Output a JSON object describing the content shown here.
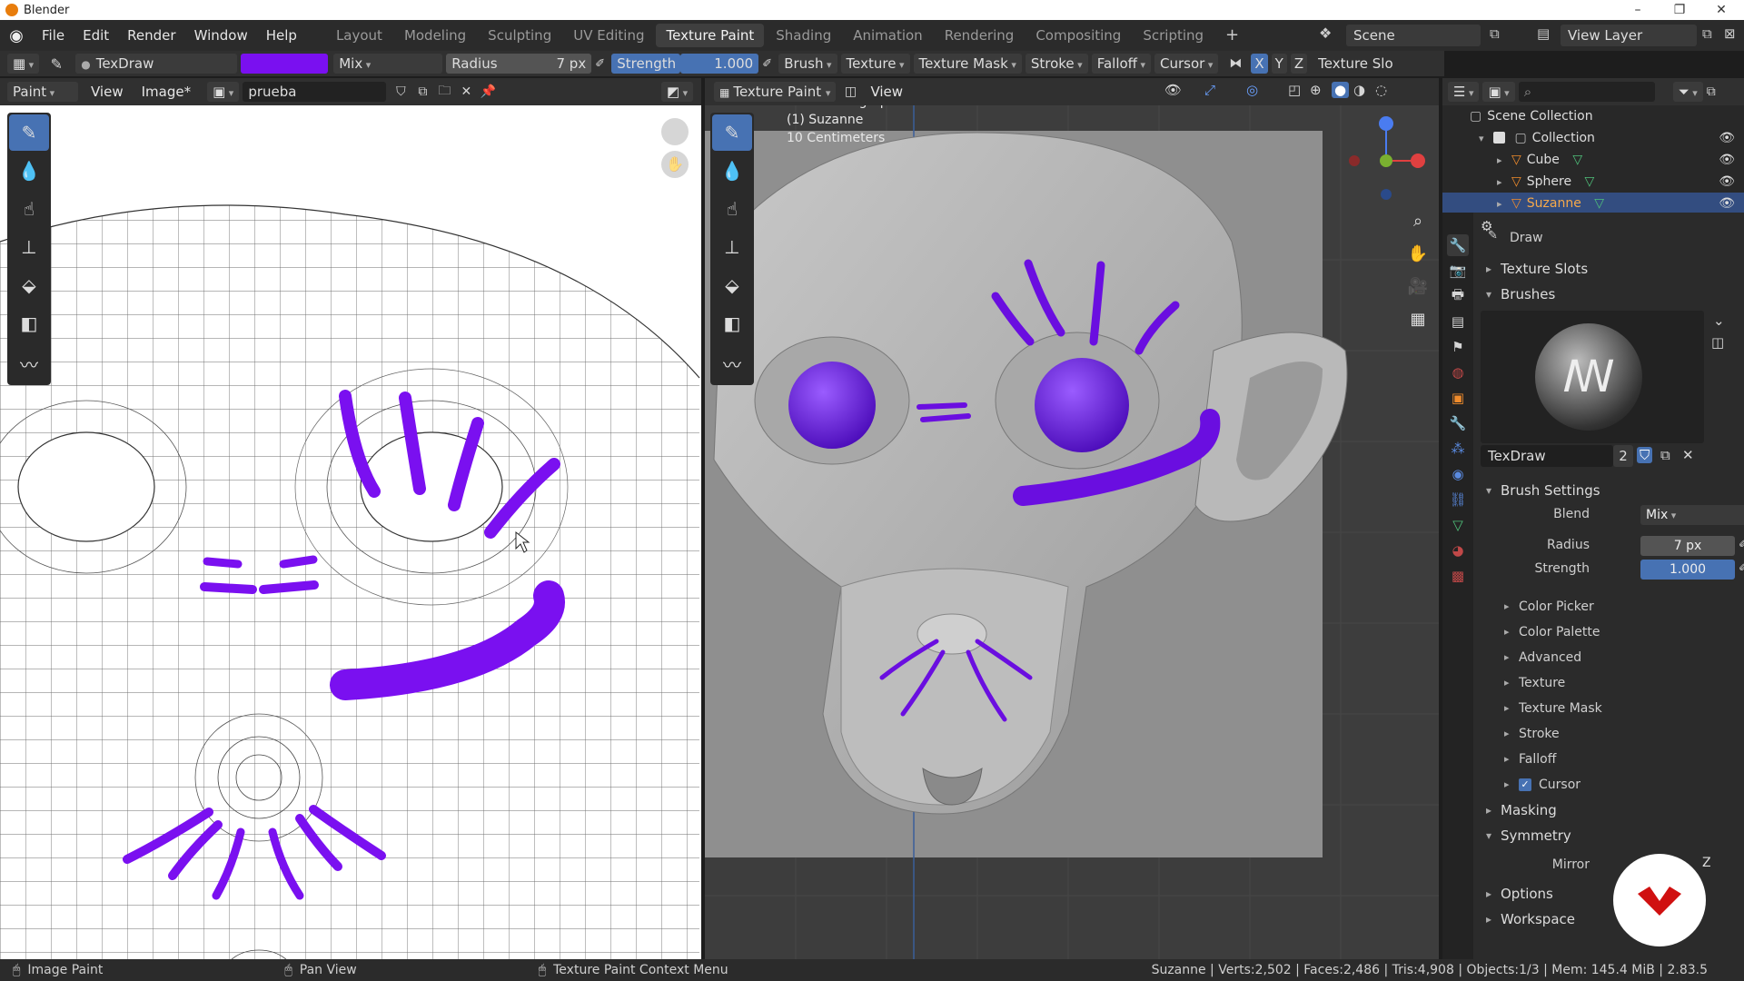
{
  "window": {
    "title": "Blender",
    "minimize": "–",
    "maximize": "❐",
    "close": "✕"
  },
  "menu": [
    "File",
    "Edit",
    "Render",
    "Window",
    "Help"
  ],
  "workspaces": [
    "Layout",
    "Modeling",
    "Sculpting",
    "UV Editing",
    "Texture Paint",
    "Shading",
    "Animation",
    "Rendering",
    "Compositing",
    "Scripting",
    "+"
  ],
  "active_workspace": "Texture Paint",
  "scene": {
    "name": "Scene",
    "view_layer": "View Layer"
  },
  "toolheader": {
    "brush_name": "TexDraw",
    "brush_color": "#7a10f0",
    "blend": "Mix",
    "radius_label": "Radius",
    "radius_value": "7 px",
    "strength_label": "Strength",
    "strength_value": "1.000",
    "menus": [
      "Brush",
      "Texture",
      "Texture Mask",
      "Stroke",
      "Falloff",
      "Cursor"
    ],
    "axes": [
      "X",
      "Y",
      "Z"
    ],
    "texture_slots": "Texture Slo"
  },
  "image_editor": {
    "mode": "Paint",
    "menus": [
      "View",
      "Image*"
    ],
    "image_name": "prueba"
  },
  "viewport": {
    "mode": "Texture Paint",
    "menus": [
      "View"
    ],
    "overlay_lines": [
      "Front Orthographic",
      "(1) Suzanne",
      "10 Centimeters"
    ]
  },
  "outliner": {
    "root": "Scene Collection",
    "collection": "Collection",
    "objects": [
      "Cube",
      "Sphere",
      "Suzanne"
    ],
    "selected": "Suzanne"
  },
  "properties": {
    "tool_name": "Draw",
    "panels": {
      "texture_slots": "Texture Slots",
      "brushes": "Brushes",
      "brush_settings": "Brush Settings",
      "masking": "Masking",
      "symmetry": "Symmetry",
      "options": "Options",
      "workspace": "Workspace"
    },
    "brush_datablock": {
      "name": "TexDraw",
      "users": "2"
    },
    "blend_label": "Blend",
    "blend_value": "Mix",
    "radius_label": "Radius",
    "radius_value": "7 px",
    "strength_label": "Strength",
    "strength_value": "1.000",
    "subpanels": [
      "Color Picker",
      "Color Palette",
      "Advanced",
      "Texture",
      "Texture Mask",
      "Stroke",
      "Falloff",
      "Cursor"
    ],
    "mirror_label": "Mirror",
    "mirror_axis": "Z"
  },
  "statusbar": {
    "left": "Image Paint",
    "middle": "Pan View",
    "context": "Texture Paint Context Menu",
    "stats": "Suzanne | Verts:2,502 | Faces:2,486 | Tris:4,908 | Objects:1/3 | Mem: 145.4 MiB | 2.83.5"
  },
  "colors": {
    "accent": "#4772b3",
    "paint": "#7a10f0",
    "selected_row": "#334d80"
  }
}
